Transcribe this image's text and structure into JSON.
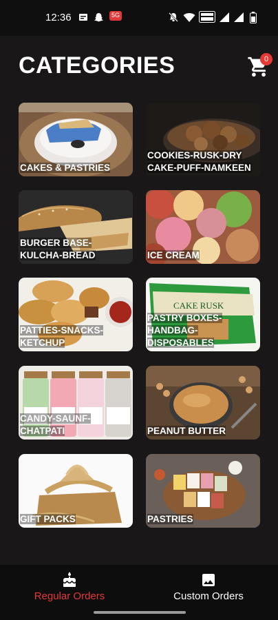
{
  "status_bar": {
    "time": "12:36",
    "notification_badge": "5G",
    "icons": [
      "message-icon",
      "snapchat-icon",
      "app-badge-icon",
      "mute-icon",
      "wifi-icon",
      "volte-icon",
      "signal-icon",
      "signal-icon",
      "battery-icon"
    ]
  },
  "header": {
    "title": "CATEGORIES",
    "cart_count": "0"
  },
  "categories": [
    {
      "label": "CAKES & PASTRIES",
      "image": "cake"
    },
    {
      "label": "COOKIES-RUSK-DRY CAKE-PUFF-NAMKEEN",
      "image": "cookies"
    },
    {
      "label": "BURGER BASE-KULCHA-BREAD",
      "image": "bread"
    },
    {
      "label": "ICE CREAM",
      "image": "icecream"
    },
    {
      "label": "PATTIES-SNACKS-KETCHUP",
      "image": "patties"
    },
    {
      "label": "PASTRY BOXES-HANDBAG-DISPOSABLES",
      "image": "rusk-box"
    },
    {
      "label": "CANDY-SAUNF-CHATPATI",
      "image": "candy-jars"
    },
    {
      "label": "PEANUT BUTTER",
      "image": "peanut-butter"
    },
    {
      "label": "GIFT PACKS",
      "image": "gift"
    },
    {
      "label": "PASTRIES",
      "image": "pastries"
    }
  ],
  "bottom_nav": {
    "items": [
      {
        "label": "Regular Orders",
        "active": true
      },
      {
        "label": "Custom Orders",
        "active": false
      }
    ],
    "active_color": "#e53935"
  },
  "image_text": {
    "rusk_package": "CAKE RUSK"
  }
}
